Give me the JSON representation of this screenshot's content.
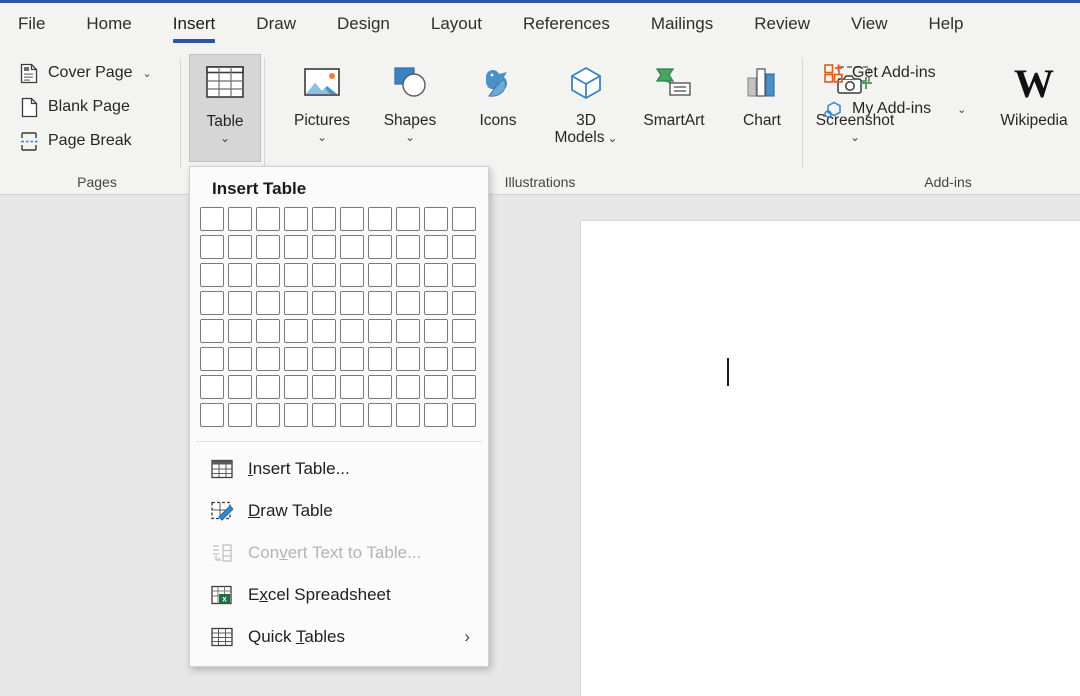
{
  "app": {
    "accent_blue": "#2b579a",
    "ribbon_bg": "#f3f3f2",
    "workspace_bg": "#e7e7e7"
  },
  "tabs": [
    {
      "label": "File",
      "active": false
    },
    {
      "label": "Home",
      "active": false
    },
    {
      "label": "Insert",
      "active": true
    },
    {
      "label": "Draw",
      "active": false
    },
    {
      "label": "Design",
      "active": false
    },
    {
      "label": "Layout",
      "active": false
    },
    {
      "label": "References",
      "active": false
    },
    {
      "label": "Mailings",
      "active": false
    },
    {
      "label": "Review",
      "active": false
    },
    {
      "label": "View",
      "active": false
    },
    {
      "label": "Help",
      "active": false
    }
  ],
  "groups": {
    "pages": {
      "label": "Pages",
      "items": [
        {
          "label": "Cover Page",
          "icon": "cover-page-icon",
          "has_dropdown": true
        },
        {
          "label": "Blank Page",
          "icon": "blank-page-icon",
          "has_dropdown": false
        },
        {
          "label": "Page Break",
          "icon": "page-break-icon",
          "has_dropdown": false
        }
      ]
    },
    "tables": {
      "button": {
        "label": "Table",
        "icon": "table-icon",
        "has_dropdown": true,
        "active": true
      }
    },
    "illustrations": {
      "label": "Illustrations",
      "items": [
        {
          "label": "Pictures",
          "icon": "pictures-icon",
          "has_dropdown": true
        },
        {
          "label": "Shapes",
          "icon": "shapes-icon",
          "has_dropdown": true
        },
        {
          "label": "Icons",
          "icon": "icons-icon",
          "has_dropdown": false
        },
        {
          "label": "3D\nModels",
          "label_line1": "3D",
          "label_line2": "Models",
          "icon": "3d-models-icon",
          "has_dropdown": true
        },
        {
          "label": "SmartArt",
          "icon": "smartart-icon",
          "has_dropdown": false
        },
        {
          "label": "Chart",
          "icon": "chart-icon",
          "has_dropdown": false
        },
        {
          "label": "Screenshot",
          "icon": "screenshot-icon",
          "has_dropdown": true
        }
      ]
    },
    "addins": {
      "label": "Add-ins",
      "items": [
        {
          "label": "Get Add-ins",
          "icon": "get-addins-icon",
          "has_dropdown": false
        },
        {
          "label": "My Add-ins",
          "icon": "my-addins-icon",
          "has_dropdown": true
        }
      ],
      "wikipedia": {
        "label": "Wikipedia",
        "icon": "wikipedia-w-icon"
      }
    }
  },
  "table_menu": {
    "title": "Insert Table",
    "grid": {
      "columns": 10,
      "rows": 8,
      "selected_columns": 0,
      "selected_rows": 0
    },
    "items": [
      {
        "label": "Insert Table...",
        "icon": "insert-table-icon",
        "disabled": false,
        "has_submenu": false,
        "accel_index": 0
      },
      {
        "label": "Draw Table",
        "icon": "draw-table-icon",
        "disabled": false,
        "has_submenu": false,
        "accel_index": 0
      },
      {
        "label": "Convert Text to Table...",
        "icon": "convert-text-to-table-icon",
        "disabled": true,
        "has_submenu": false,
        "accel_index": 11
      },
      {
        "label": "Excel Spreadsheet",
        "icon": "excel-spreadsheet-icon",
        "disabled": false,
        "has_submenu": false,
        "accel_index": 1
      },
      {
        "label": "Quick Tables",
        "icon": "quick-tables-icon",
        "disabled": false,
        "has_submenu": true,
        "accel_index": 6
      }
    ],
    "submenu_arrow": "›"
  },
  "document": {
    "cursor_visible": true
  }
}
